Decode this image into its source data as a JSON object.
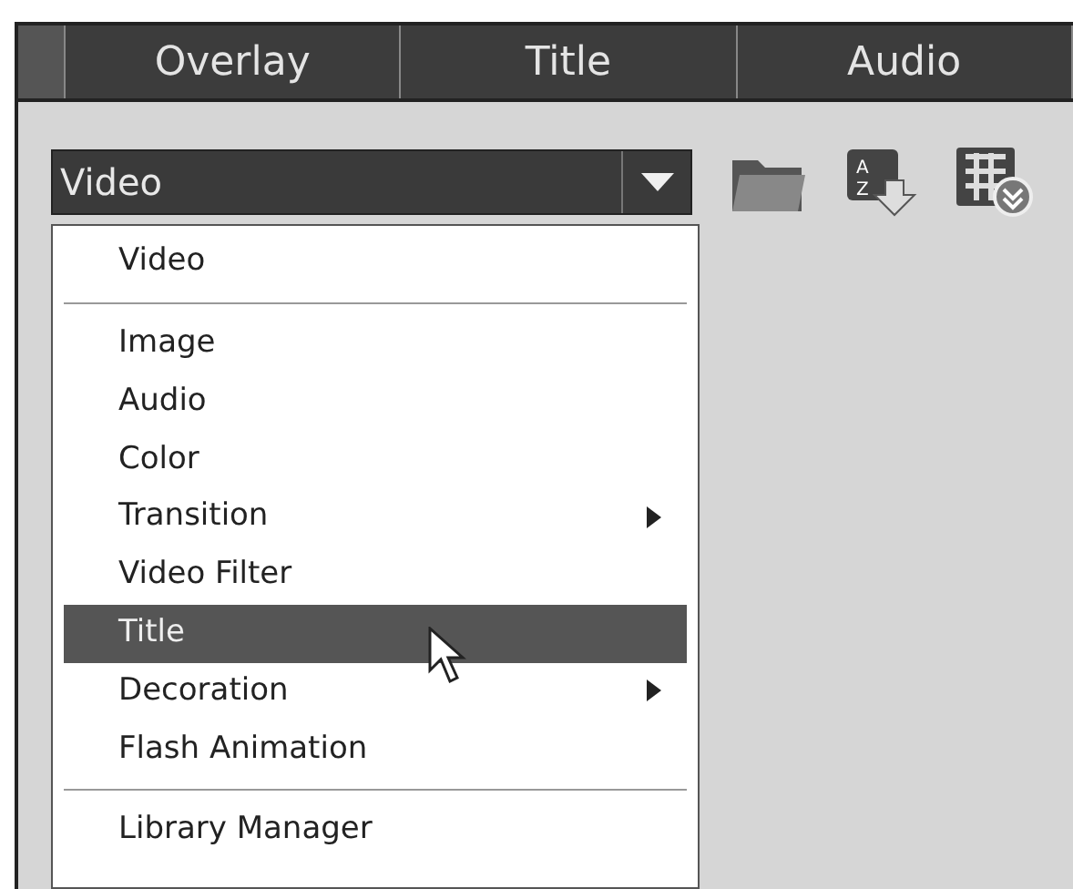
{
  "tabs": [
    {
      "label": "Overlay",
      "selected": false
    },
    {
      "label": "Title",
      "selected": false
    },
    {
      "label": "Audio",
      "selected": false
    }
  ],
  "library_dropdown": {
    "value": "Video",
    "open": true
  },
  "sort_button": {
    "letters": [
      "A",
      "Z"
    ]
  },
  "menu": [
    {
      "kind": "item",
      "label": "Video",
      "selected": false,
      "submenu": false
    },
    {
      "kind": "separator"
    },
    {
      "kind": "item",
      "label": "Image",
      "selected": false,
      "submenu": false
    },
    {
      "kind": "item",
      "label": "Audio",
      "selected": false,
      "submenu": false
    },
    {
      "kind": "item",
      "label": "Color",
      "selected": false,
      "submenu": false
    },
    {
      "kind": "item",
      "label": "Transition",
      "selected": false,
      "submenu": true
    },
    {
      "kind": "item",
      "label": "Video Filter",
      "selected": false,
      "submenu": false
    },
    {
      "kind": "item",
      "label": "Title",
      "selected": true,
      "submenu": false
    },
    {
      "kind": "item",
      "label": "Decoration",
      "selected": false,
      "submenu": true
    },
    {
      "kind": "item",
      "label": "Flash Animation",
      "selected": false,
      "submenu": false
    },
    {
      "kind": "separator"
    },
    {
      "kind": "item",
      "label": "Library Manager",
      "selected": false,
      "submenu": false
    }
  ]
}
